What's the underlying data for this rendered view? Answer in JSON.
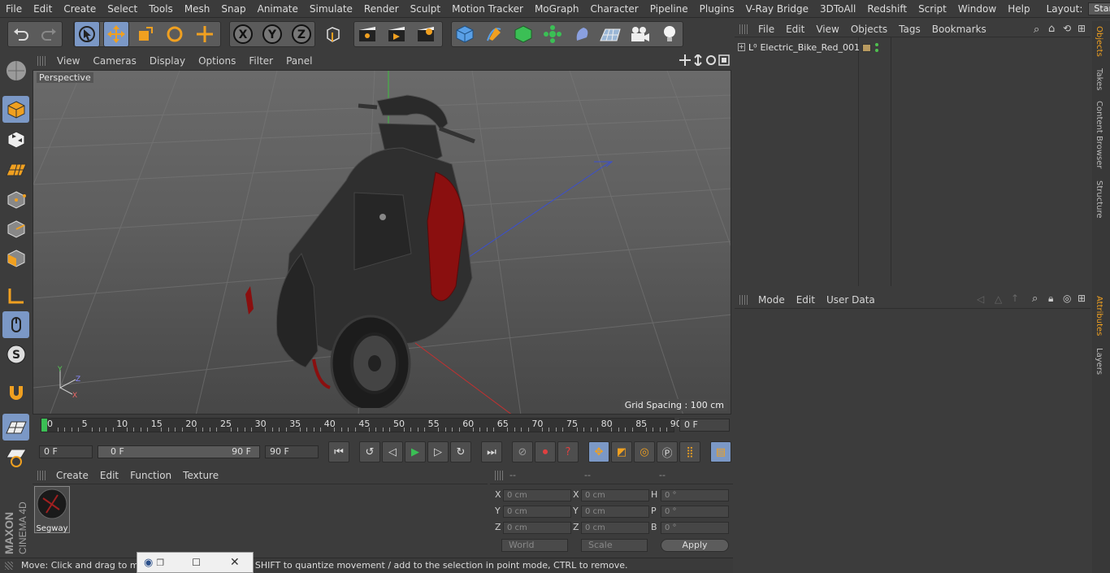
{
  "menubar": {
    "items": [
      "File",
      "Edit",
      "Create",
      "Select",
      "Tools",
      "Mesh",
      "Snap",
      "Animate",
      "Simulate",
      "Render",
      "Sculpt",
      "Motion Tracker",
      "MoGraph",
      "Character",
      "Pipeline",
      "Plugins",
      "V-Ray Bridge",
      "3DToAll",
      "Redshift",
      "Script",
      "Window",
      "Help"
    ],
    "layout_label": "Layout:",
    "layout_value": "Startup"
  },
  "viewport": {
    "menu": [
      "View",
      "Cameras",
      "Display",
      "Options",
      "Filter",
      "Panel"
    ],
    "camera_label": "Perspective",
    "grid_spacing": "Grid Spacing : 100 cm"
  },
  "timeline": {
    "ticks": [
      "0",
      "5",
      "10",
      "15",
      "20",
      "25",
      "30",
      "35",
      "40",
      "45",
      "50",
      "55",
      "60",
      "65",
      "70",
      "75",
      "80",
      "85",
      "90"
    ],
    "current_frame": "0 F"
  },
  "transport": {
    "start_field": "0 F",
    "range_start": "0 F",
    "range_end": "90 F",
    "end_field": "90 F"
  },
  "material_panel": {
    "menu": [
      "Create",
      "Edit",
      "Function",
      "Texture"
    ],
    "material_name": "Segway"
  },
  "coord_panel": {
    "headers": [
      "--",
      "--",
      "--"
    ],
    "rows": [
      {
        "a": "X",
        "av": "0 cm",
        "b": "X",
        "bv": "0 cm",
        "c": "H",
        "cv": "0 °"
      },
      {
        "a": "Y",
        "av": "0 cm",
        "b": "Y",
        "bv": "0 cm",
        "c": "P",
        "cv": "0 °"
      },
      {
        "a": "Z",
        "av": "0 cm",
        "b": "Z",
        "bv": "0 cm",
        "c": "B",
        "cv": "0 °"
      }
    ],
    "world_label": "World",
    "scale_label": "Scale",
    "apply_label": "Apply"
  },
  "object_panel": {
    "menu": [
      "File",
      "Edit",
      "View",
      "Objects",
      "Tags",
      "Bookmarks"
    ],
    "object_name": "Electric_Bike_Red_001"
  },
  "attributes_panel": {
    "menu": [
      "Mode",
      "Edit",
      "User Data"
    ]
  },
  "side_tabs": {
    "top": [
      "Objects",
      "Takes",
      "Content Browser",
      "Structure"
    ],
    "bottom": [
      "Attributes",
      "Layers"
    ]
  },
  "branding": {
    "maxon": "MAXON",
    "product": "CINEMA 4D"
  },
  "status": {
    "text": "Move: Click and drag to move elements. Hold down SHIFT to quantize movement / add to the selection in point mode, CTRL to remove."
  },
  "colors": {
    "accent": "#7b98c6",
    "selection_blue": "#5aa0e6",
    "object_green": "#4fc04f"
  }
}
